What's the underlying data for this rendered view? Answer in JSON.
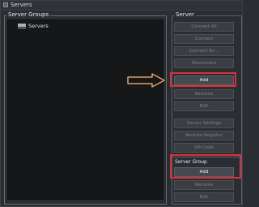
{
  "window": {
    "title": "Servers"
  },
  "server_groups": {
    "label": "Server Groups",
    "tree": [
      {
        "label": "Servers"
      }
    ]
  },
  "server": {
    "label": "Server",
    "buttons": [
      {
        "label": "Connect All",
        "enabled": false
      },
      {
        "label": "Connect",
        "enabled": false
      },
      {
        "label": "Connect As...",
        "enabled": false
      },
      {
        "label": "Disconnect",
        "enabled": false
      },
      {
        "label": "Add",
        "enabled": true
      },
      {
        "label": "Remove",
        "enabled": false
      },
      {
        "label": "Edit",
        "enabled": false
      },
      {
        "label": "Server Settings",
        "enabled": false
      },
      {
        "label": "Remote Register",
        "enabled": false
      },
      {
        "label": "QR Code",
        "enabled": false
      }
    ]
  },
  "server_group": {
    "label": "Server Group",
    "buttons": [
      {
        "label": "Add",
        "enabled": true
      },
      {
        "label": "Remove",
        "enabled": false
      },
      {
        "label": "Edit",
        "enabled": false
      }
    ]
  },
  "colors": {
    "highlight": "#d9303b",
    "arrow": "#e0a060"
  }
}
